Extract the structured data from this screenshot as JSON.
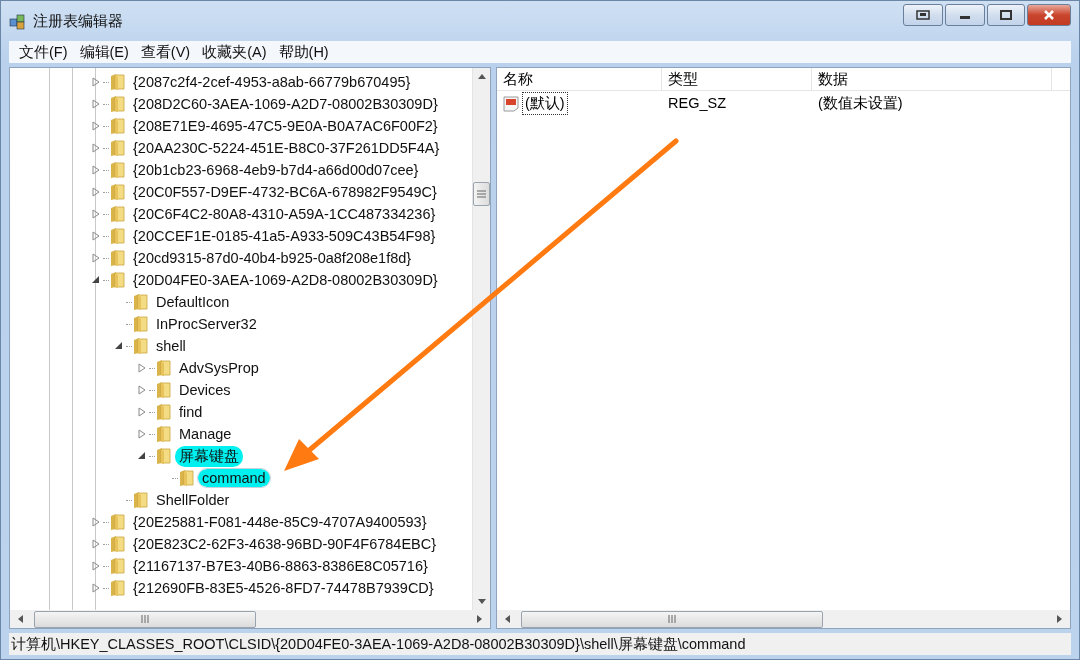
{
  "window": {
    "title": "注册表编辑器"
  },
  "menu": [
    "文件(F)",
    "编辑(E)",
    "查看(V)",
    "收藏夹(A)",
    "帮助(H)"
  ],
  "tree": {
    "nodes": [
      {
        "label": "{2087c2f4-2cef-4953-a8ab-66779b670495}",
        "expandable": true,
        "expanded": false,
        "selected": false,
        "highlighted": false
      },
      {
        "label": "{208D2C60-3AEA-1069-A2D7-08002B30309D}",
        "expandable": true,
        "expanded": false,
        "selected": false,
        "highlighted": false
      },
      {
        "label": "{208E71E9-4695-47C5-9E0A-B0A7AC6F00F2}",
        "expandable": true,
        "expanded": false,
        "selected": false,
        "highlighted": false
      },
      {
        "label": "{20AA230C-5224-451E-B8C0-37F261DD5F4A}",
        "expandable": true,
        "expanded": false,
        "selected": false,
        "highlighted": false
      },
      {
        "label": "{20b1cb23-6968-4eb9-b7d4-a66d00d07cee}",
        "expandable": true,
        "expanded": false,
        "selected": false,
        "highlighted": false
      },
      {
        "label": "{20C0F557-D9EF-4732-BC6A-678982F9549C}",
        "expandable": true,
        "expanded": false,
        "selected": false,
        "highlighted": false
      },
      {
        "label": "{20C6F4C2-80A8-4310-A59A-1CC487334236}",
        "expandable": true,
        "expanded": false,
        "selected": false,
        "highlighted": false
      },
      {
        "label": "{20CCEF1E-0185-41a5-A933-509C43B54F98}",
        "expandable": true,
        "expanded": false,
        "selected": false,
        "highlighted": false
      },
      {
        "label": "{20cd9315-87d0-40b4-b925-0a8f208e1f8d}",
        "expandable": true,
        "expanded": false,
        "selected": false,
        "highlighted": false
      },
      {
        "label": "{20D04FE0-3AEA-1069-A2D8-08002B30309D}",
        "expandable": true,
        "expanded": true,
        "selected": false,
        "highlighted": false,
        "children": [
          {
            "label": "DefaultIcon",
            "expandable": false,
            "selected": false,
            "highlighted": false
          },
          {
            "label": "InProcServer32",
            "expandable": false,
            "selected": false,
            "highlighted": false
          },
          {
            "label": "shell",
            "expandable": true,
            "expanded": true,
            "selected": false,
            "highlighted": false,
            "children": [
              {
                "label": "AdvSysProp",
                "expandable": true,
                "expanded": false,
                "selected": false,
                "highlighted": false
              },
              {
                "label": "Devices",
                "expandable": true,
                "expanded": false,
                "selected": false,
                "highlighted": false
              },
              {
                "label": "find",
                "expandable": true,
                "expanded": false,
                "selected": false,
                "highlighted": false
              },
              {
                "label": "Manage",
                "expandable": true,
                "expanded": false,
                "selected": false,
                "highlighted": false
              },
              {
                "label": "屏幕键盘",
                "expandable": true,
                "expanded": true,
                "selected": false,
                "highlighted": true,
                "children": [
                  {
                    "label": "command",
                    "expandable": false,
                    "selected": true,
                    "highlighted": true
                  }
                ]
              }
            ]
          },
          {
            "label": "ShellFolder",
            "expandable": false,
            "selected": false,
            "highlighted": false
          }
        ]
      },
      {
        "label": "{20E25881-F081-448e-85C9-4707A9400593}",
        "expandable": true,
        "expanded": false,
        "selected": false,
        "highlighted": false
      },
      {
        "label": "{20E823C2-62F3-4638-96BD-90F4F6784EBC}",
        "expandable": true,
        "expanded": false,
        "selected": false,
        "highlighted": false
      },
      {
        "label": "{21167137-B7E3-40B6-8863-8386E8C05716}",
        "expandable": true,
        "expanded": false,
        "selected": false,
        "highlighted": false
      },
      {
        "label": "{212690FB-83E5-4526-8FD7-74478B7939CD}",
        "expandable": true,
        "expanded": false,
        "selected": false,
        "highlighted": false
      }
    ]
  },
  "values": {
    "columns": [
      "名称",
      "类型",
      "数据"
    ],
    "rows": [
      {
        "name": "(默认)",
        "type": "REG_SZ",
        "data": "(数值未设置)",
        "selected": true
      }
    ]
  },
  "status_bar": "计算机\\HKEY_CLASSES_ROOT\\CLSID\\{20D04FE0-3AEA-1069-A2D8-08002B30309D}\\shell\\屏幕键盘\\command",
  "annotation": {
    "kind": "arrow"
  }
}
